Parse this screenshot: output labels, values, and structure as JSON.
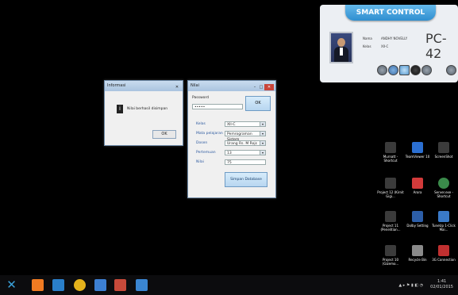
{
  "smart_control": {
    "title": "SMART CONTROL",
    "nama_label": "Nama",
    "nama_value": "ANDHY NOVELLY",
    "kelas_label": "Kelas",
    "kelas_value": "XII-C",
    "pc_name": "PC-42",
    "buttons": [
      "volume-icon",
      "user-icon",
      "window-icon",
      "lock-icon",
      "chat-icon",
      "power-icon"
    ]
  },
  "info_dialog": {
    "title": "Informasi",
    "message": "Nilai berhasil disimpan",
    "ok": "OK"
  },
  "nilai_window": {
    "title": "Nilai",
    "password_label": "Password",
    "password_value": "•••••",
    "ok": "OK",
    "fields": [
      {
        "label": "Kelas",
        "value": "XII-C"
      },
      {
        "label": "Mata pelajaran",
        "value": "Pemrograman Sistem"
      },
      {
        "label": "Dosen",
        "value": "Urang Rs. M Rojs"
      },
      {
        "label": "Pertemuan",
        "value": "13"
      },
      {
        "label": "Nilai",
        "value": "75"
      }
    ],
    "save": "Simpan Database"
  },
  "desktop_icons": [
    {
      "label": "Murnatt - Shortcut",
      "color": "#3b3b3b"
    },
    {
      "label": "TeamViewer 10",
      "color": "#2b6fd1"
    },
    {
      "label": "ScreenShot",
      "color": "#3b3b3b"
    },
    {
      "label": "Project 12 (Kirnit Gigi...",
      "color": "#3b3b3b"
    },
    {
      "label": "Arora",
      "color": "#d23a3a"
    },
    {
      "label": "Server.exe - Shortcut",
      "color": "#3a8a4a"
    },
    {
      "label": "Project 11 (Penelitian...",
      "color": "#3b3b3b"
    },
    {
      "label": "Dolby Setting",
      "color": "#2c5ea8"
    },
    {
      "label": "TuneUp 1-Click Mai...",
      "color": "#3a7ac8"
    },
    {
      "label": "Project 10 (Gizemo...",
      "color": "#3b3b3b"
    },
    {
      "label": "Recycle Bin",
      "color": "#8a8a8a"
    },
    {
      "label": "3G Connection",
      "color": "#c03030"
    }
  ],
  "taskbar": {
    "icons": [
      {
        "name": "windows-start-icon",
        "color": "#3aa0d8"
      },
      {
        "name": "xampp-icon",
        "color": "#f07b22"
      },
      {
        "name": "app-icon",
        "color": "#2a7fc9"
      },
      {
        "name": "chrome-icon",
        "color": "#e4b21c"
      },
      {
        "name": "explorer-icon",
        "color": "#3c7fd2"
      },
      {
        "name": "media-icon",
        "color": "#c84a3a"
      },
      {
        "name": "photos-icon",
        "color": "#3a86d2"
      }
    ],
    "time": "1:41",
    "date": "02/01/2015"
  }
}
